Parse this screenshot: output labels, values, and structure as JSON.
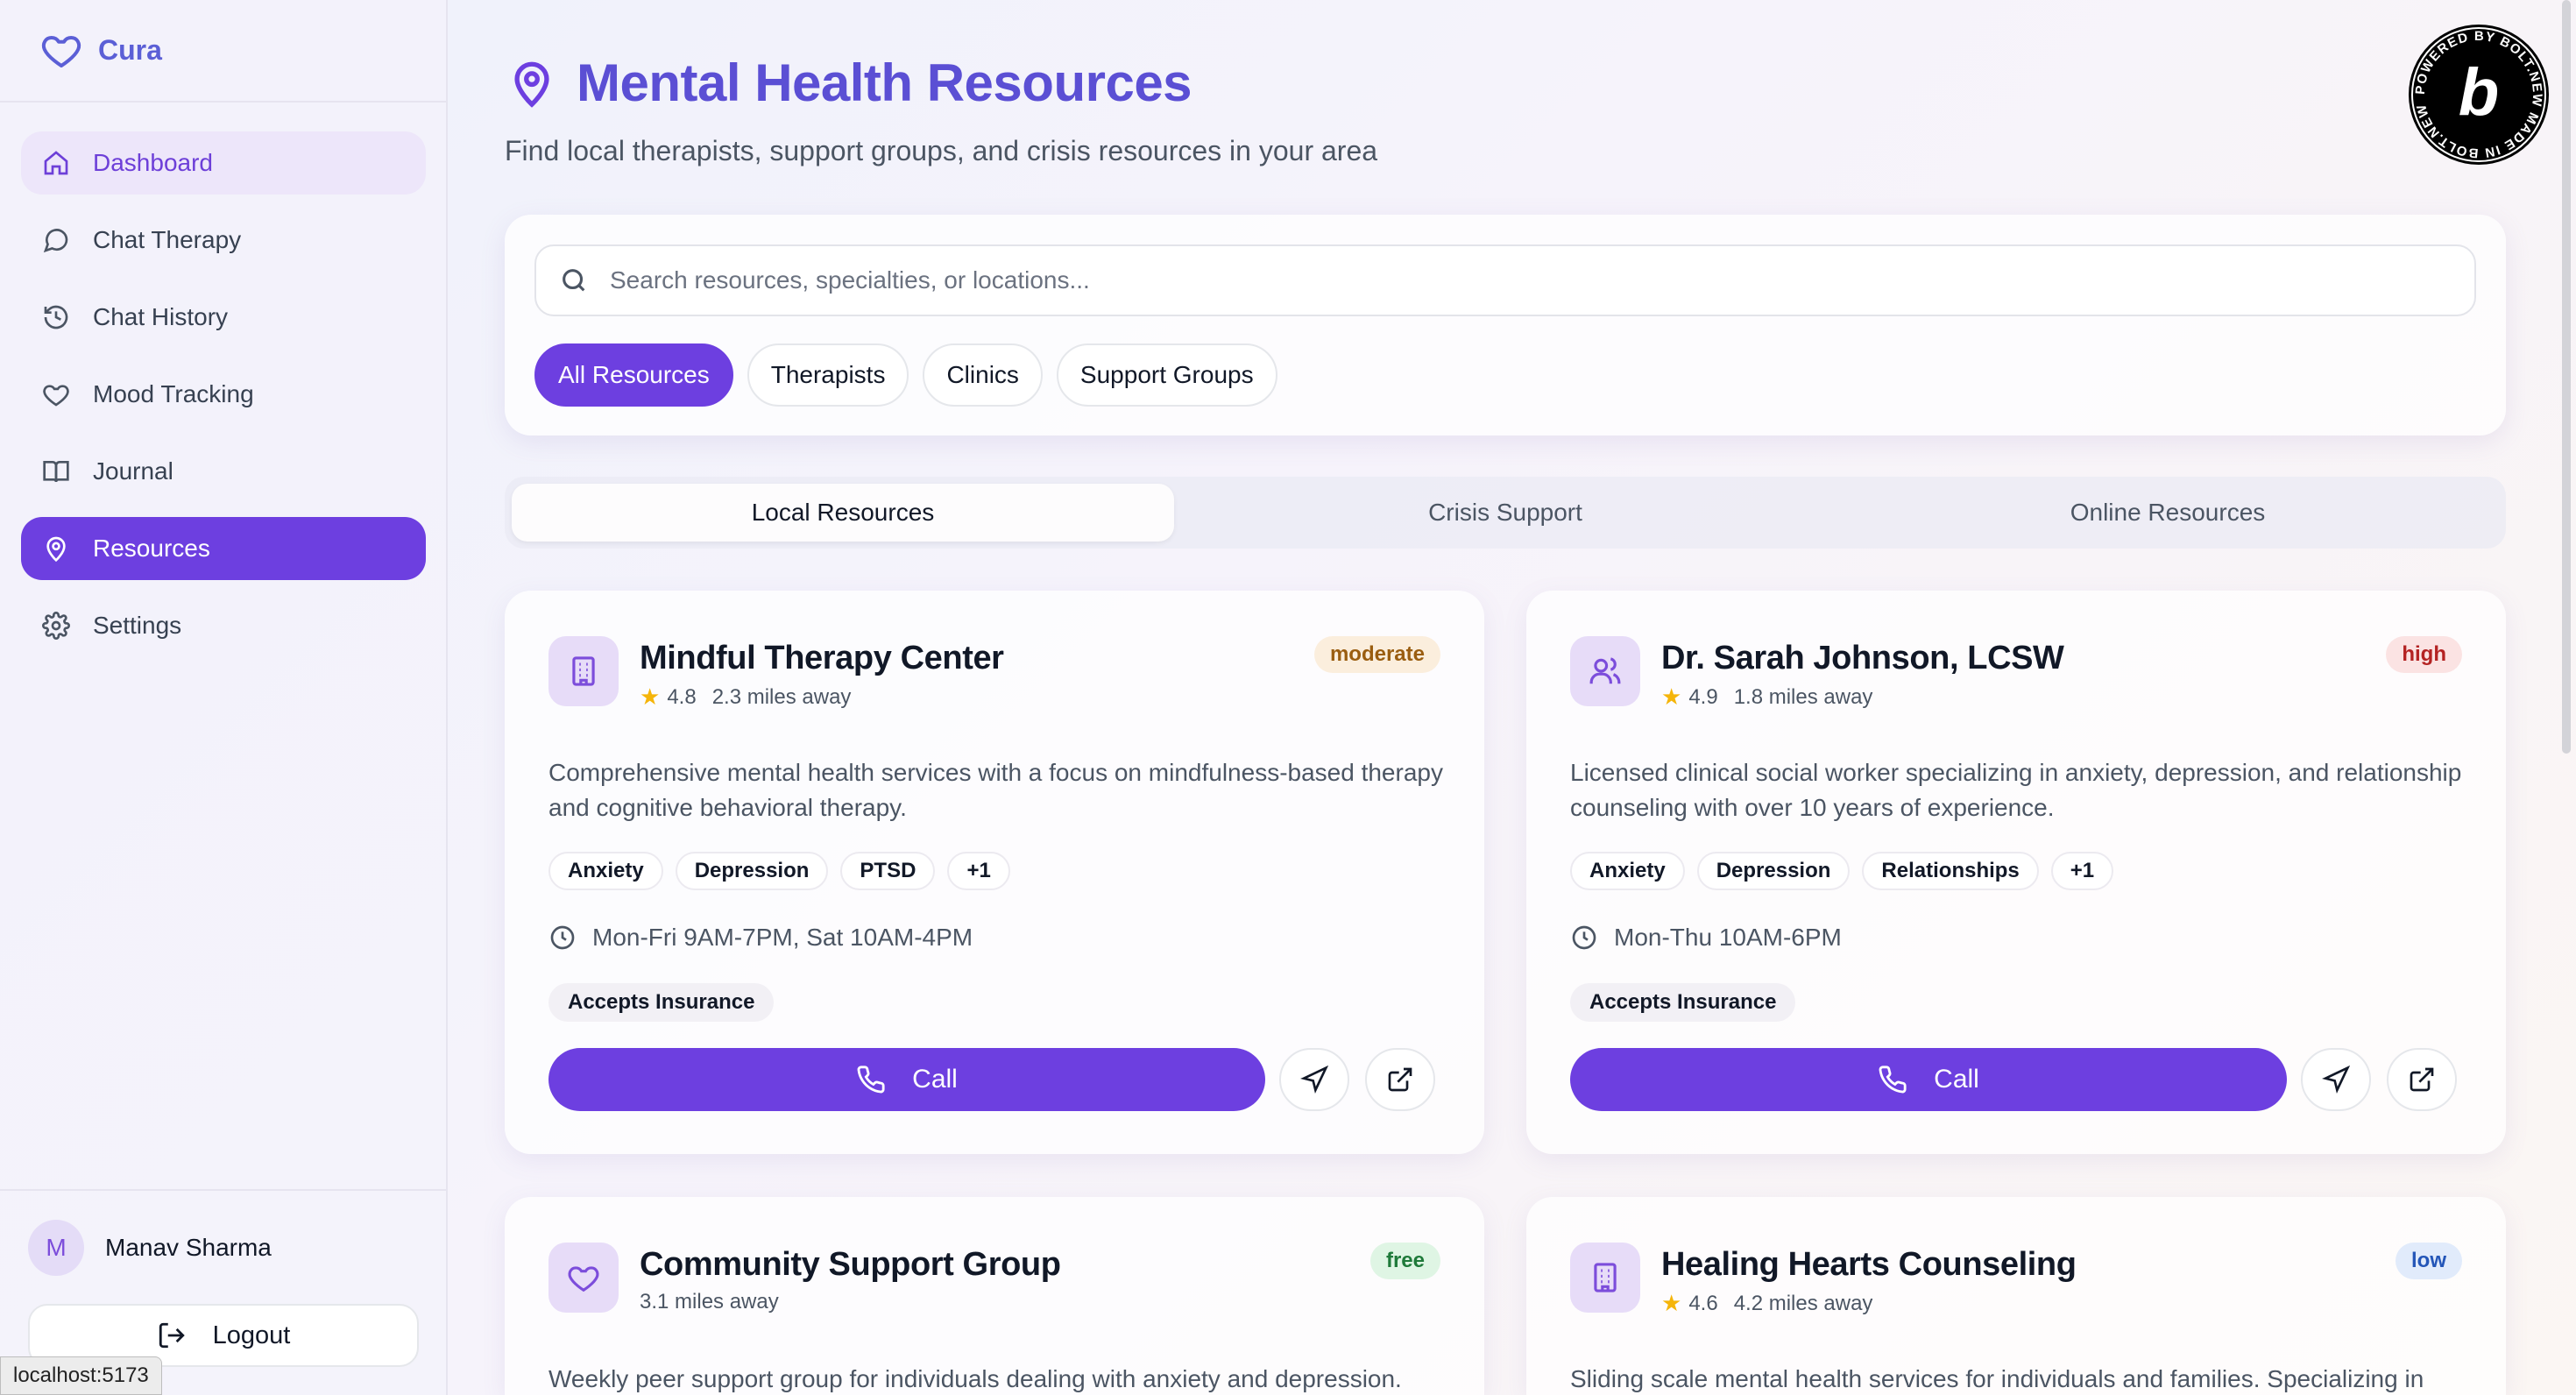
{
  "app": {
    "name": "Cura",
    "status_url": "localhost:5173"
  },
  "sidebar": {
    "items": [
      {
        "label": "Dashboard",
        "icon": "home-icon"
      },
      {
        "label": "Chat Therapy",
        "icon": "message-circle-icon"
      },
      {
        "label": "Chat History",
        "icon": "history-icon"
      },
      {
        "label": "Mood Tracking",
        "icon": "heart-icon"
      },
      {
        "label": "Journal",
        "icon": "book-open-icon"
      },
      {
        "label": "Resources",
        "icon": "map-pin-icon"
      },
      {
        "label": "Settings",
        "icon": "gear-icon"
      }
    ],
    "active": "Resources",
    "user": {
      "initial": "M",
      "name": "Manav Sharma"
    },
    "logout_label": "Logout"
  },
  "header": {
    "title": "Mental Health Resources",
    "subtitle": "Find local therapists, support groups, and crisis resources in your area"
  },
  "badge": {
    "text": "POWERED BY BOLT.NEW MADE IN BOLT.NEW",
    "letter": "b"
  },
  "search": {
    "placeholder": "Search resources, specialties, or locations...",
    "value": "",
    "filters": [
      "All Resources",
      "Therapists",
      "Clinics",
      "Support Groups"
    ],
    "active_filter": "All Resources"
  },
  "tabs": {
    "items": [
      "Local Resources",
      "Crisis Support",
      "Online Resources"
    ],
    "active": "Local Resources"
  },
  "colors": {
    "accent": "#6d3fe0",
    "title": "#5b4fd4",
    "star": "#f5b50a"
  },
  "resources": [
    {
      "name": "Mindful Therapy Center",
      "icon": "building-icon",
      "rating": "4.8",
      "distance": "2.3 miles away",
      "cost": "moderate",
      "description": "Comprehensive mental health services with a focus on mindfulness-based therapy and cognitive behavioral therapy.",
      "tags": [
        "Anxiety",
        "Depression",
        "PTSD",
        "+1"
      ],
      "hours": "Mon-Fri 9AM-7PM, Sat 10AM-4PM",
      "insurance": "Accepts Insurance",
      "call_label": "Call"
    },
    {
      "name": "Dr. Sarah Johnson, LCSW",
      "icon": "users-icon",
      "rating": "4.9",
      "distance": "1.8 miles away",
      "cost": "high",
      "description": "Licensed clinical social worker specializing in anxiety, depression, and relationship counseling with over 10 years of experience.",
      "tags": [
        "Anxiety",
        "Depression",
        "Relationships",
        "+1"
      ],
      "hours": "Mon-Thu 10AM-6PM",
      "insurance": "Accepts Insurance",
      "call_label": "Call"
    },
    {
      "name": "Community Support Group",
      "icon": "heart-icon",
      "distance": "3.1 miles away",
      "cost": "free",
      "description": "Weekly peer support group for individuals dealing with anxiety and depression."
    },
    {
      "name": "Healing Hearts Counseling",
      "icon": "building-icon",
      "rating": "4.6",
      "distance": "4.2 miles away",
      "cost": "low",
      "description": "Sliding scale mental health services for individuals and families. Specializing in"
    }
  ]
}
